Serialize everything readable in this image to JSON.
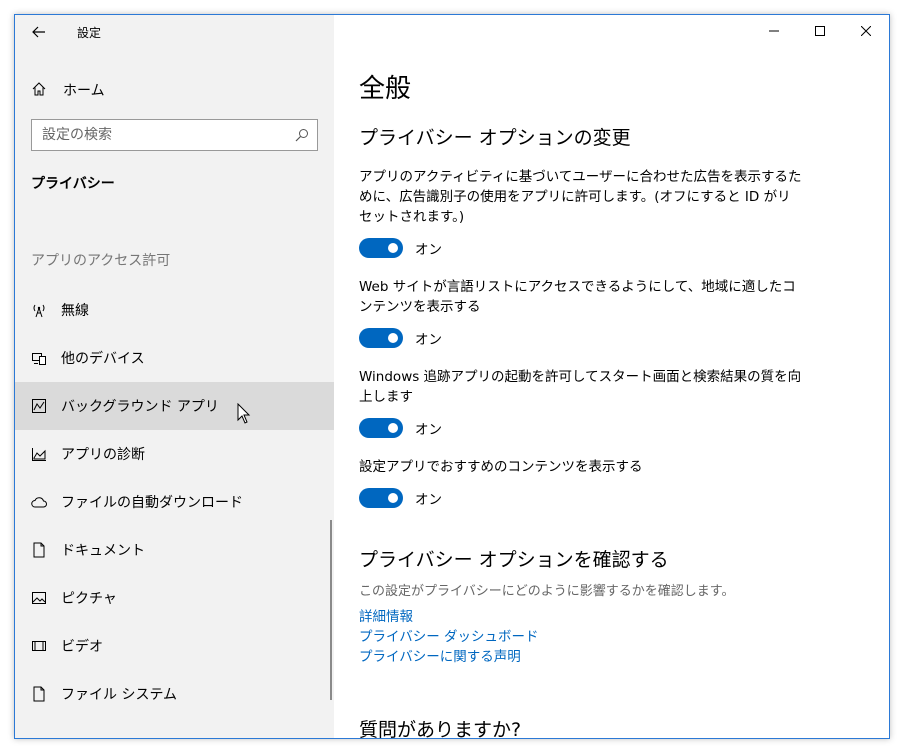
{
  "window": {
    "title": "設定",
    "minimize_glyph": "—",
    "maximize_glyph": "☐",
    "close_glyph": "✕",
    "accent": "#0067c0"
  },
  "sidebar": {
    "home_label": "ホーム",
    "search_placeholder": "設定の検索",
    "privacy_heading": "プライバシー",
    "access_heading": "アプリのアクセス許可",
    "items": [
      {
        "label": "無線",
        "icon": "antenna-icon"
      },
      {
        "label": "他のデバイス",
        "icon": "devices-icon"
      },
      {
        "label": "バックグラウンド アプリ",
        "icon": "background-apps-icon",
        "active": true
      },
      {
        "label": "アプリの診断",
        "icon": "diagnostics-icon"
      },
      {
        "label": "ファイルの自動ダウンロード",
        "icon": "cloud-icon"
      },
      {
        "label": "ドキュメント",
        "icon": "document-icon"
      },
      {
        "label": "ピクチャ",
        "icon": "picture-icon"
      },
      {
        "label": "ビデオ",
        "icon": "video-icon"
      },
      {
        "label": "ファイル システム",
        "icon": "file-system-icon"
      }
    ]
  },
  "main": {
    "title": "全般",
    "section1_title": "プライバシー オプションの変更",
    "options": [
      {
        "text": "アプリのアクティビティに基づいてユーザーに合わせた広告を表示するために、広告識別子の使用をアプリに許可します。(オフにすると ID がリセットされます。)",
        "state": "オン"
      },
      {
        "text": "Web サイトが言語リストにアクセスできるようにして、地域に適したコンテンツを表示する",
        "state": "オン"
      },
      {
        "text": "Windows 追跡アプリの起動を許可してスタート画面と検索結果の質を向上します",
        "state": "オン"
      },
      {
        "text": "設定アプリでおすすめのコンテンツを表示する",
        "state": "オン"
      }
    ],
    "section2_title": "プライバシー オプションを確認する",
    "section2_desc": "この設定がプライバシーにどのように影響するかを確認します。",
    "links": [
      "詳細情報",
      "プライバシー ダッシュボード",
      "プライバシーに関する声明"
    ],
    "section3_title": "質問がありますか?"
  }
}
